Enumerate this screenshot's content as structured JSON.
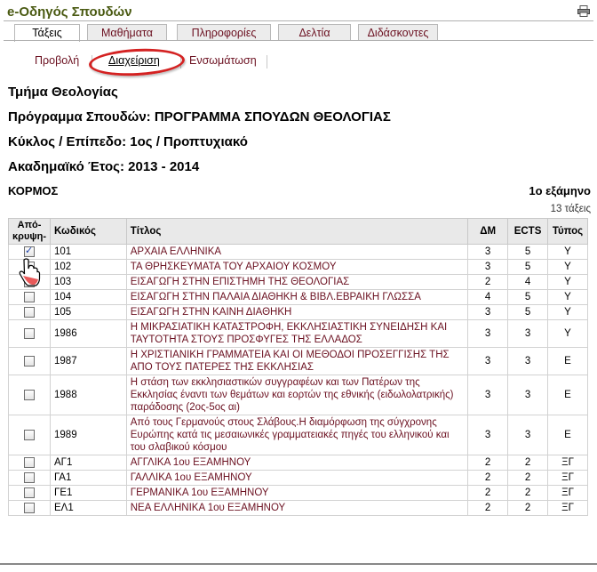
{
  "app": {
    "title": "e-Οδηγός Σπουδών",
    "print_icon": "printer-icon"
  },
  "tabs": [
    {
      "label": "Τάξεις",
      "active": true
    },
    {
      "label": "Μαθήματα",
      "active": false
    },
    {
      "label": "Πληροφορίες",
      "active": false
    },
    {
      "label": "Δελτία",
      "active": false
    },
    {
      "label": "Διδάσκοντες",
      "active": false
    }
  ],
  "subnav": [
    {
      "label": "Προβολή",
      "active": false
    },
    {
      "label": "Διαχείριση",
      "active": true
    },
    {
      "label": "Ενσωμάτωση",
      "active": false
    }
  ],
  "info": {
    "department": "Τμήμα Θεολογίας",
    "program": "Πρόγραμμα Σπουδών: ΠΡΟΓΡΑΜΜΑ ΣΠΟΥΔΩΝ ΘΕΟΛΟΓΙΑΣ",
    "cycle": "Κύκλος / Επίπεδο: 1ος / Προπτυχιακό",
    "year": "Ακαδημαϊκό Έτος: 2013 - 2014"
  },
  "section": {
    "name": "ΚΟΡΜΟΣ",
    "semester": "1ο εξάμηνο",
    "count": "13 τάξεις"
  },
  "table": {
    "headers": {
      "hide": "Από-κρυψη-",
      "code": "Κωδικός",
      "title": "Τίτλος",
      "dm": "ΔΜ",
      "ects": "ECTS",
      "type": "Τύπος"
    },
    "rows": [
      {
        "checked": true,
        "code": "101",
        "title": "ΑΡΧΑΙΑ ΕΛΛΗΝΙΚΑ",
        "dm": "3",
        "ects": "5",
        "type": "Υ"
      },
      {
        "checked": false,
        "code": "102",
        "title": "ΤΑ ΘΡΗΣΚΕΥΜΑΤΑ ΤΟΥ ΑΡΧΑΙΟΥ ΚΟΣΜΟΥ",
        "dm": "3",
        "ects": "5",
        "type": "Υ"
      },
      {
        "checked": false,
        "code": "103",
        "title": "ΕΙΣΑΓΩΓΗ ΣΤΗΝ ΕΠΙΣΤΗΜΗ ΤΗΣ ΘΕΟΛΟΓΙΑΣ",
        "dm": "2",
        "ects": "4",
        "type": "Υ"
      },
      {
        "checked": false,
        "code": "104",
        "title": "ΕΙΣΑΓΩΓΗ ΣΤΗΝ ΠΑΛΑΙΑ ΔΙΑΘΗΚΗ & ΒΙΒΛ.ΕΒΡΑΙΚΗ ΓΛΩΣΣΑ",
        "dm": "4",
        "ects": "5",
        "type": "Υ"
      },
      {
        "checked": false,
        "code": "105",
        "title": "ΕΙΣΑΓΩΓΗ ΣΤΗΝ ΚΑΙΝΗ ΔΙΑΘΗΚΗ",
        "dm": "3",
        "ects": "5",
        "type": "Υ"
      },
      {
        "checked": false,
        "code": "1986",
        "title": "Η ΜΙΚΡΑΣΙΑΤΙΚΗ ΚΑΤΑΣΤΡΟΦΗ, ΕΚΚΛΗΣΙΑΣΤΙΚΗ ΣΥΝΕΙΔΗΣΗ ΚΑΙ ΤΑΥΤΟΤΗΤΑ ΣΤΟΥΣ ΠΡΟΣΦΥΓΕΣ ΤΗΣ ΕΛΛΑΔΟΣ",
        "dm": "3",
        "ects": "3",
        "type": "Υ"
      },
      {
        "checked": false,
        "code": "1987",
        "title": "Η ΧΡΙΣΤΙΑΝΙΚΗ ΓΡΑΜΜΑΤΕΙΑ ΚΑΙ ΟΙ ΜΕΘΟΔΟΙ ΠΡΟΣΕΓΓΙΣΗΣ ΤΗΣ ΑΠΟ ΤΟΥΣ ΠΑΤΕΡΕΣ ΤΗΣ ΕΚΚΛΗΣΙΑΣ",
        "dm": "3",
        "ects": "3",
        "type": "Ε"
      },
      {
        "checked": false,
        "code": "1988",
        "title": "Η στάση των εκκλησιαστικών συγγραφέων και των Πατέρων της Εκκλησίας έναντι των θεμάτων και εορτών της εθνικής (ειδωλολατρικής) παράδοσης (2ος-5ος αι)",
        "dm": "3",
        "ects": "3",
        "type": "Ε"
      },
      {
        "checked": false,
        "code": "1989",
        "title": "Από τους Γερμανούς στους Σλάβους.Η διαμόρφωση της σύγχρονης Ευρώπης κατά τις μεσαιωνικές γραμματειακές πηγές του ελληνικού και του σλαβικού κόσμου",
        "dm": "3",
        "ects": "3",
        "type": "Ε"
      },
      {
        "checked": false,
        "code": "ΑΓ1",
        "title": "ΑΓΓΛΙΚΑ 1ου ΕΞΑΜΗΝΟΥ",
        "dm": "2",
        "ects": "2",
        "type": "ΞΓ"
      },
      {
        "checked": false,
        "code": "ΓΑ1",
        "title": "ΓΑΛΛΙΚΑ 1ου ΕΞΑΜΗΝΟΥ",
        "dm": "2",
        "ects": "2",
        "type": "ΞΓ"
      },
      {
        "checked": false,
        "code": "ΓΕ1",
        "title": "ΓΕΡΜΑΝΙΚΑ 1ου ΕΞΑΜΗΝΟΥ",
        "dm": "2",
        "ects": "2",
        "type": "ΞΓ"
      },
      {
        "checked": false,
        "code": "ΕΛ1",
        "title": "ΝΕΑ ΕΛΛΗΝΙΚΑ 1ου ΕΞΑΜΗΝΟΥ",
        "dm": "2",
        "ects": "2",
        "type": "ΞΓ"
      }
    ]
  },
  "colors": {
    "link": "#6b1020",
    "title": "#4a5a12",
    "highlight": "#d42222"
  }
}
